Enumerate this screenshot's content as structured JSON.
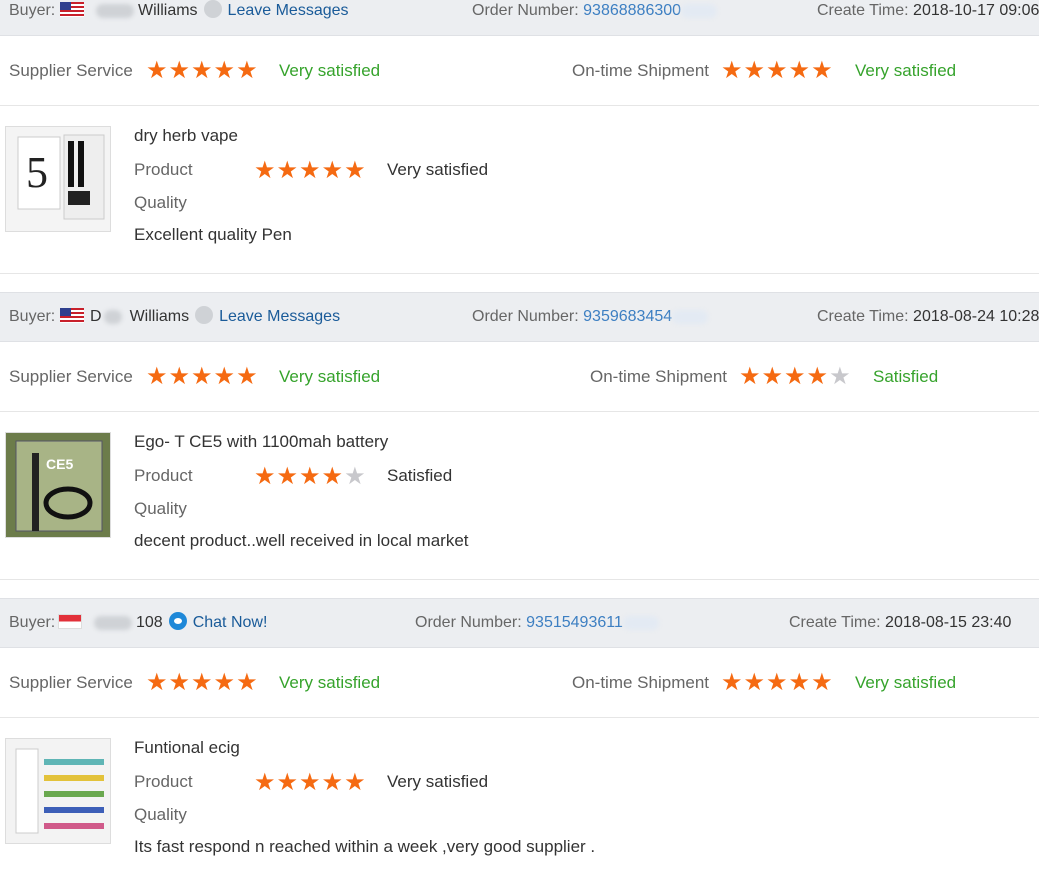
{
  "labels": {
    "buyer": "Buyer:",
    "order_number": "Order Number:",
    "create_time": "Create Time:",
    "supplier_service": "Supplier Service",
    "ontime_shipment": "On-time Shipment",
    "product": "Product",
    "quality": "Quality"
  },
  "colors": {
    "star_on": "#f56a12",
    "star_off": "#c8c8cc",
    "satisfied": "#36a32c",
    "link": "#1a5b99"
  },
  "reviews": [
    {
      "buyer_flag": "us-flag",
      "buyer_name": "Williams",
      "action_icon": "grey-avatar-icon",
      "action_label": "Leave Messages",
      "order_number": "93868886300",
      "create_time": "2018-10-17 09:06",
      "supplier_rating": 5,
      "supplier_text": "Very satisfied",
      "shipment_rating": 5,
      "shipment_text": "Very satisfied",
      "product_name": "dry herb vape",
      "product_rating": 5,
      "product_text": "Very satisfied",
      "comment": "Excellent quality Pen",
      "thumb": "vape-pen-kit-image"
    },
    {
      "buyer_flag": "us-flag",
      "buyer_name": "Williams",
      "buyer_initial": "D",
      "action_icon": "grey-avatar-icon",
      "action_label": "Leave Messages",
      "order_number": "9359683454",
      "create_time": "2018-08-24 10:28",
      "supplier_rating": 5,
      "supplier_text": "Very satisfied",
      "shipment_rating": 4,
      "shipment_text": "Satisfied",
      "product_name": "Ego- T CE5 with 1100mah battery",
      "product_rating": 4,
      "product_text": "Satisfied",
      "comment": "decent product..well received in local market",
      "thumb": "ce5-blister-pack-image"
    },
    {
      "buyer_flag": "sg-flag",
      "buyer_name": "108",
      "action_icon": "chat-bubble-icon",
      "action_label": "Chat Now!",
      "order_number": "93515493611",
      "create_time": "2018-08-15 23:40",
      "supplier_rating": 5,
      "supplier_text": "Very satisfied",
      "shipment_rating": 5,
      "shipment_text": "Very satisfied",
      "product_name": "Funtional ecig",
      "product_rating": 5,
      "product_text": "Very satisfied",
      "comment": "Its fast respond n reached within a week ,very good supplier .",
      "thumb": "colored-ecig-set-image"
    }
  ]
}
